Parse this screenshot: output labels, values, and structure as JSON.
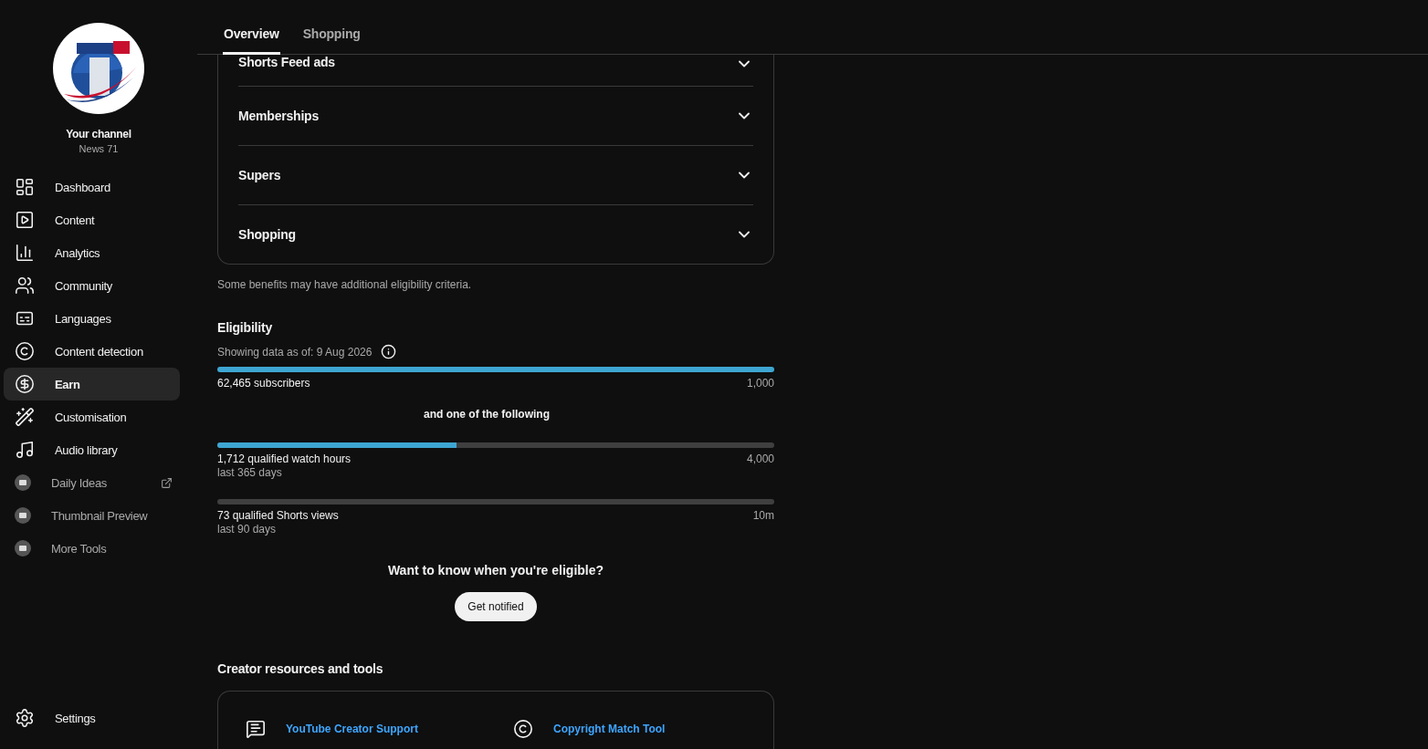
{
  "sidebar": {
    "channel_label": "Your channel",
    "channel_name": "News 71",
    "items": [
      {
        "label": "Dashboard",
        "kind": "nav",
        "selected": false
      },
      {
        "label": "Content",
        "kind": "nav",
        "selected": false
      },
      {
        "label": "Analytics",
        "kind": "nav",
        "selected": false
      },
      {
        "label": "Community",
        "kind": "nav",
        "selected": false
      },
      {
        "label": "Languages",
        "kind": "nav",
        "selected": false
      },
      {
        "label": "Content detection",
        "kind": "nav",
        "selected": false
      },
      {
        "label": "Earn",
        "kind": "nav",
        "selected": true
      },
      {
        "label": "Customisation",
        "kind": "nav",
        "selected": false
      },
      {
        "label": "Audio library",
        "kind": "nav",
        "selected": false
      },
      {
        "label": "Daily Ideas",
        "kind": "extension",
        "external": true,
        "selected": false
      },
      {
        "label": "Thumbnail Preview",
        "kind": "extension",
        "external": false,
        "selected": false
      },
      {
        "label": "More Tools",
        "kind": "extension",
        "external": false,
        "selected": false
      }
    ],
    "bottom_items": [
      {
        "label": "Settings",
        "selected": false
      }
    ]
  },
  "tabs": [
    {
      "label": "Overview",
      "selected": true
    },
    {
      "label": "Shopping",
      "selected": false
    }
  ],
  "benefits": [
    "Shorts Feed ads",
    "Memberships",
    "Supers",
    "Shopping"
  ],
  "benefits_note": "Some benefits may have additional eligibility criteria.",
  "eligibility": {
    "title": "Eligibility",
    "data_date": "Showing data as of: 9 Aug 2026",
    "primary": {
      "label": "62,465 subscribers",
      "target": "1,000",
      "level": 1
    },
    "separator": "and one of the following",
    "alternatives": [
      {
        "label": "1,712 qualified watch hours",
        "period": "last 365 days",
        "target": "4,000",
        "level": 0.43
      },
      {
        "label": "73 qualified Shorts views",
        "period": "last 90 days",
        "target": "10m",
        "level": 0
      }
    ],
    "prompt": "Want to know when you're eligible?",
    "button": "Get notified"
  },
  "resources": {
    "title": "Creator resources and tools",
    "links": [
      "YouTube Creator Support",
      "Copyright Match Tool"
    ]
  }
}
